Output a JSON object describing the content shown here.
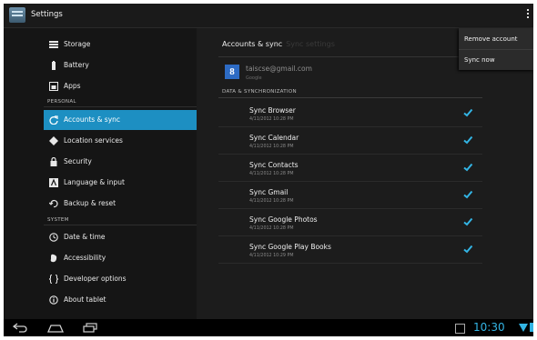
{
  "app_bar": {
    "title": "Settings"
  },
  "popup_menu": {
    "items": [
      "Remove account",
      "Sync now"
    ]
  },
  "sidebar": {
    "items": [
      {
        "label": "Storage",
        "icon": "storage-icon"
      },
      {
        "label": "Battery",
        "icon": "battery-icon"
      },
      {
        "label": "Apps",
        "icon": "apps-icon"
      },
      {
        "label": "Accounts & sync",
        "icon": "sync-icon",
        "active": true
      },
      {
        "label": "Location services",
        "icon": "location-icon"
      },
      {
        "label": "Security",
        "icon": "lock-icon"
      },
      {
        "label": "Language & input",
        "icon": "language-icon"
      },
      {
        "label": "Backup & reset",
        "icon": "backup-icon"
      },
      {
        "label": "Date & time",
        "icon": "clock-icon"
      },
      {
        "label": "Accessibility",
        "icon": "accessibility-icon"
      },
      {
        "label": "Developer options",
        "icon": "braces-icon"
      },
      {
        "label": "About tablet",
        "icon": "info-icon"
      }
    ],
    "sections": {
      "personal": "PERSONAL",
      "system": "SYSTEM"
    }
  },
  "main": {
    "header": "Accounts & sync",
    "header_sub": "Sync settings",
    "account": {
      "logo_letter": "8",
      "email": "taiscse@gmail.com",
      "type": "Google"
    },
    "section_label": "DATA & SYNCHRONIZATION",
    "sync_items": [
      {
        "name": "Sync Browser",
        "time": "4/11/2012 10:28 PM"
      },
      {
        "name": "Sync Calendar",
        "time": "4/11/2012 10:28 PM"
      },
      {
        "name": "Sync Contacts",
        "time": "4/11/2012 10:28 PM"
      },
      {
        "name": "Sync Gmail",
        "time": "4/11/2012 10:28 PM"
      },
      {
        "name": "Sync Google Photos",
        "time": "4/11/2012 10:28 PM"
      },
      {
        "name": "Sync Google Play Books",
        "time": "4/11/2012 10:29 PM"
      }
    ]
  },
  "status_bar": {
    "clock": "10:30"
  },
  "colors": {
    "accent": "#33b5e5",
    "active_item": "#1d8fc2"
  }
}
